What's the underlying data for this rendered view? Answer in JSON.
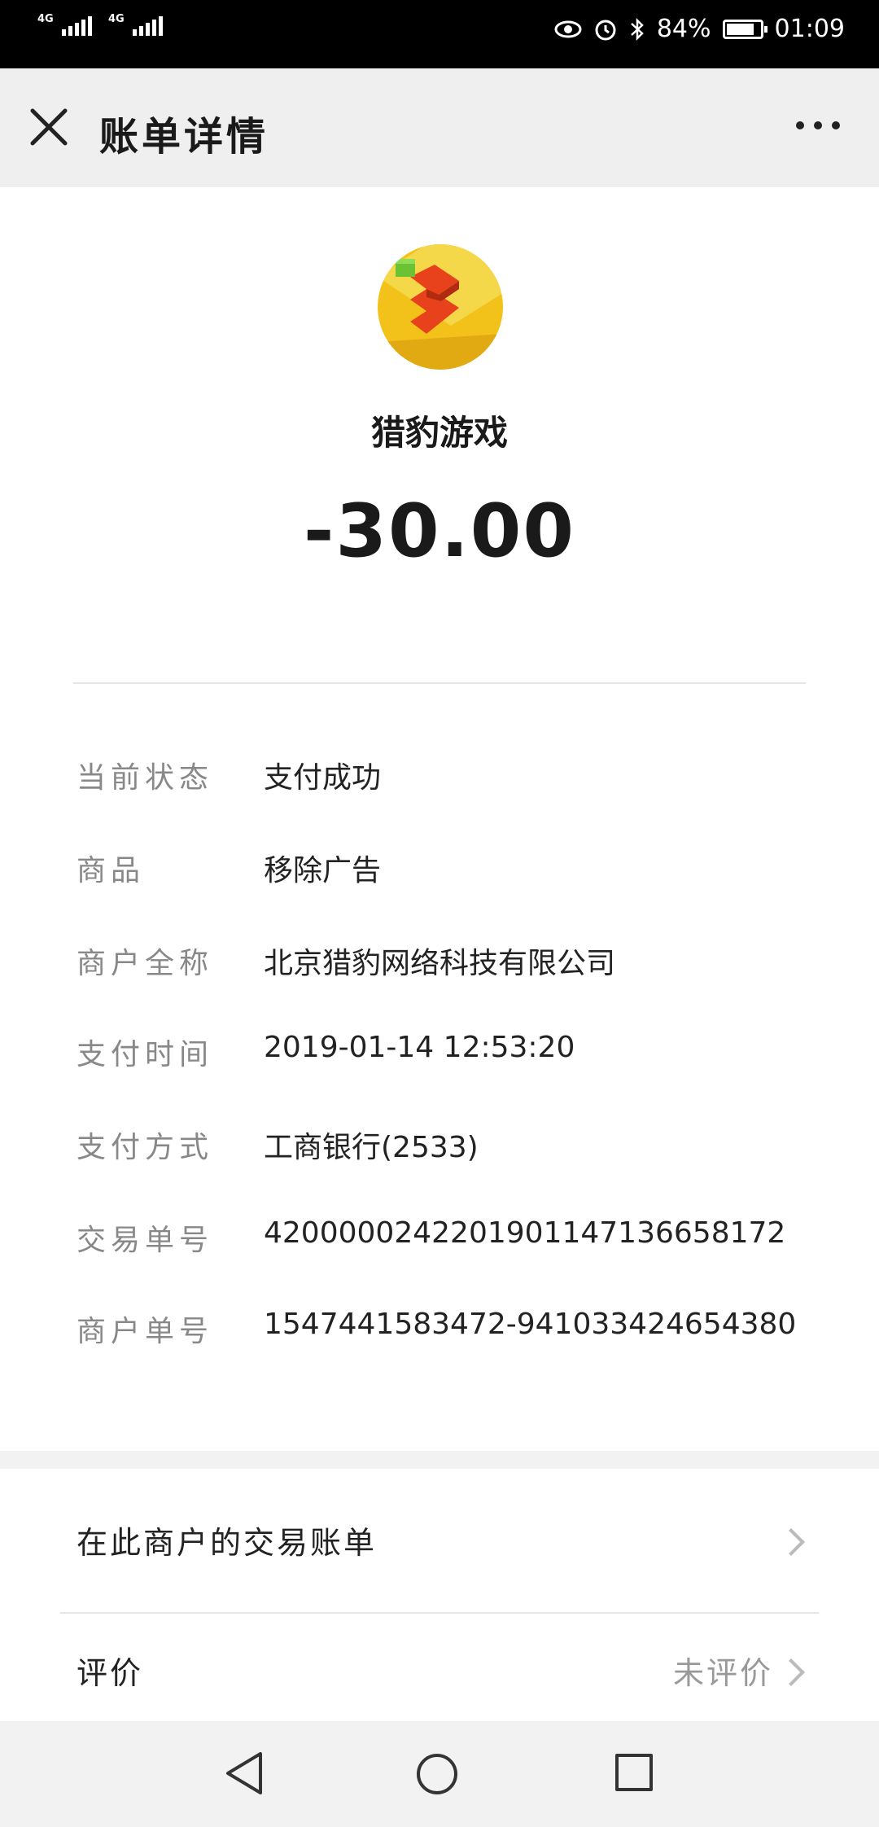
{
  "status_bar": {
    "net1": "4G",
    "net2": "4G",
    "battery_pct": "84%",
    "battery_level": 0.84,
    "time": "01:09"
  },
  "header": {
    "title": "账单详情"
  },
  "merchant": {
    "name": "猎豹游戏",
    "amount": "-30.00"
  },
  "details": [
    {
      "label": "当前状态",
      "value": "支付成功"
    },
    {
      "label": "商品",
      "value": "移除广告"
    },
    {
      "label": "商户全称",
      "value": "北京猎豹网络科技有限公司"
    },
    {
      "label": "支付时间",
      "value": "2019-01-14 12:53:20"
    },
    {
      "label": "支付方式",
      "value": "工商银行(2533)"
    },
    {
      "label": "交易单号",
      "value": "4200000242201901147136658172"
    },
    {
      "label": "商户单号",
      "value": "1547441583472-941033424654380"
    }
  ],
  "links": {
    "merchant_bills": "在此商户的交易账单",
    "review": "评价",
    "review_status": "未评价"
  },
  "icons": {
    "close": "close-icon",
    "more": "more-icon",
    "back": "nav-back-icon",
    "home": "nav-home-icon",
    "recent": "nav-recent-icon"
  }
}
